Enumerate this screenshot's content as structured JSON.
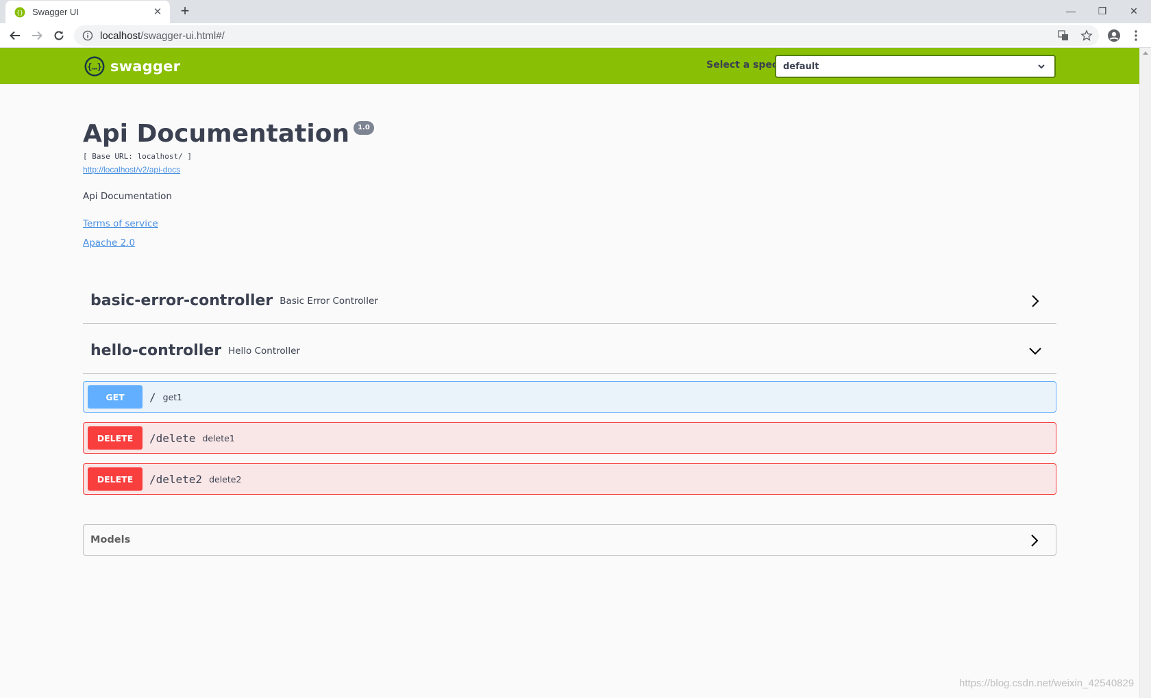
{
  "browser": {
    "tab_title": "Swagger UI",
    "new_tab": "+",
    "url_host": "localhost",
    "url_path": "/swagger-ui.html#/"
  },
  "header": {
    "logo_text": "swagger",
    "spec_label": "Select a spec",
    "spec_selected": "default",
    "accent_color": "#89bf04"
  },
  "info": {
    "title": "Api Documentation",
    "version": "1.0",
    "base_url": "[ Base URL: localhost/ ]",
    "api_docs_link": "http://localhost/v2/api-docs",
    "description": "Api Documentation",
    "terms_of_service": "Terms of service",
    "license": "Apache 2.0"
  },
  "tags": [
    {
      "name": "basic-error-controller",
      "description": "Basic Error Controller",
      "expanded": false,
      "operations": []
    },
    {
      "name": "hello-controller",
      "description": "Hello Controller",
      "expanded": true,
      "operations": [
        {
          "method": "GET",
          "path": "/",
          "summary": "get1",
          "color": "#61affe"
        },
        {
          "method": "DELETE",
          "path": "/delete",
          "summary": "delete1",
          "color": "#f93e3e"
        },
        {
          "method": "DELETE",
          "path": "/delete2",
          "summary": "delete2",
          "color": "#f93e3e"
        }
      ]
    }
  ],
  "models": {
    "title": "Models"
  },
  "watermark": "https://blog.csdn.net/weixin_42540829"
}
